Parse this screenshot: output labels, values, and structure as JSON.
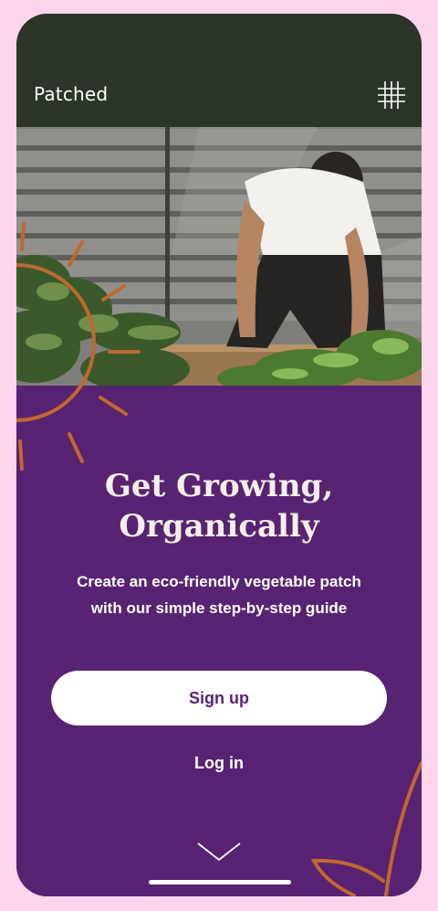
{
  "app": {
    "brand": "Patched",
    "menu_icon": "grid-menu-icon"
  },
  "hero": {
    "image_subject": "gardener-tending-raised-vegetable-bed"
  },
  "onboarding": {
    "headline_line1": "Get Growing,",
    "headline_line2": "Organically",
    "subtitle_line1": "Create an eco-friendly vegetable patch",
    "subtitle_line2": "with our simple step-by-step guide",
    "signup_label": "Sign up",
    "login_label": "Log in",
    "scroll_icon": "chevron-down-icon"
  },
  "colors": {
    "frame": "#fdd6ee",
    "header_bg": "#2b3629",
    "content_bg": "#572372",
    "accent_orange": "#c0682f",
    "button_text": "#572372",
    "headline_text": "#f6efe7"
  }
}
